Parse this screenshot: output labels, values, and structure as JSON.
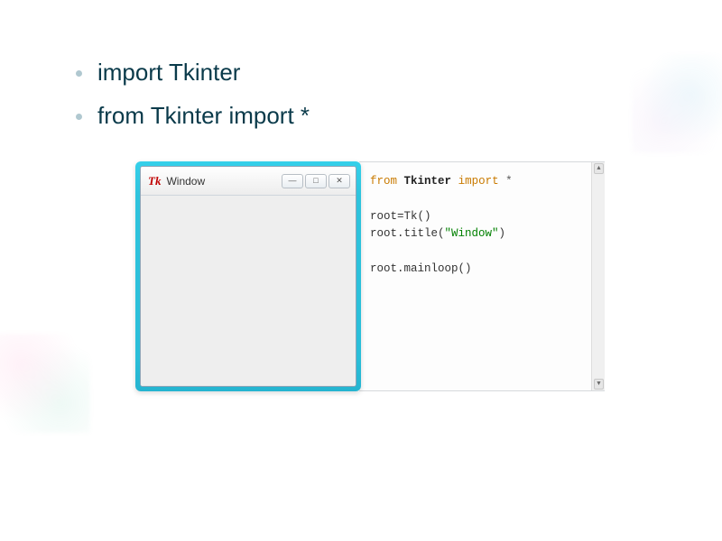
{
  "bullets": {
    "item1": "import Tkinter",
    "item2": "from Tkinter import *"
  },
  "window": {
    "icon_text": "Tk",
    "title": "Window",
    "btn_min": "—",
    "btn_max": "□",
    "btn_close": "✕"
  },
  "code": {
    "l1_from": "from",
    "l1_mod": "Tkinter",
    "l1_import": "import",
    "l1_star": "*",
    "l3": "root=Tk()",
    "l4a": "root.title(",
    "l4str": "\"Window\"",
    "l4b": ")",
    "l6": "root.mainloop()"
  },
  "scroll": {
    "up": "▲",
    "down": "▼"
  }
}
